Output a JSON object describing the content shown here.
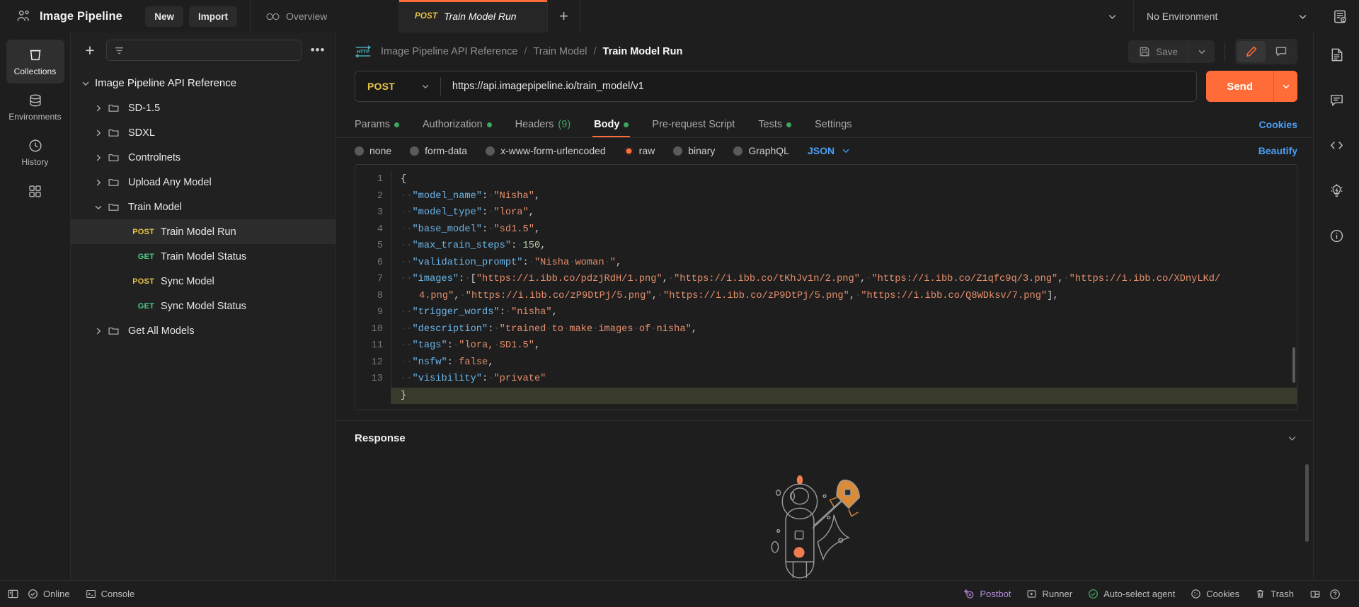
{
  "topbar": {
    "workspace_name": "Image Pipeline",
    "workspace_icon": "users-icon",
    "new_label": "New",
    "import_label": "Import",
    "tabs": [
      {
        "label": "Overview",
        "icon": "overview-glasses-icon",
        "method": "",
        "active": false
      },
      {
        "label": "Train Model Run",
        "icon": "",
        "method": "POST",
        "active": true
      }
    ],
    "new_tab_label": "+",
    "environment": "No Environment",
    "env_eye_icon": "environment-quick-look-icon"
  },
  "left_rail": [
    {
      "label": "Collections",
      "icon": "collections-icon",
      "active": true
    },
    {
      "label": "Environments",
      "icon": "environments-icon",
      "active": false
    },
    {
      "label": "History",
      "icon": "history-icon",
      "active": false
    },
    {
      "label": "",
      "icon": "apps-grid-icon",
      "active": false
    }
  ],
  "sidebar": {
    "add_icon": "plus-icon",
    "filter_icon": "filter-icon",
    "more_icon": "more-options-icon",
    "search_placeholder": "",
    "tree": [
      {
        "label": "Image Pipeline API Reference",
        "level": 0,
        "type": "collection",
        "expanded": true,
        "method": ""
      },
      {
        "label": "SD-1.5",
        "level": 1,
        "type": "folder",
        "expanded": false,
        "method": ""
      },
      {
        "label": "SDXL",
        "level": 1,
        "type": "folder",
        "expanded": false,
        "method": ""
      },
      {
        "label": "Controlnets",
        "level": 1,
        "type": "folder",
        "expanded": false,
        "method": ""
      },
      {
        "label": "Upload Any Model",
        "level": 1,
        "type": "folder",
        "expanded": false,
        "method": ""
      },
      {
        "label": "Train Model",
        "level": 1,
        "type": "folder",
        "expanded": true,
        "method": ""
      },
      {
        "label": "Train Model Run",
        "level": 2,
        "type": "request",
        "method": "POST",
        "selected": true
      },
      {
        "label": "Train Model Status",
        "level": 2,
        "type": "request",
        "method": "GET",
        "selected": false
      },
      {
        "label": "Sync Model",
        "level": 2,
        "type": "request",
        "method": "POST",
        "selected": false
      },
      {
        "label": "Sync Model Status",
        "level": 2,
        "type": "request",
        "method": "GET",
        "selected": false
      },
      {
        "label": "Get All Models",
        "level": 1,
        "type": "folder",
        "expanded": false,
        "method": ""
      }
    ]
  },
  "request": {
    "breadcrumb": {
      "icon": "http-protocol-icon",
      "items": [
        "Image Pipeline API Reference",
        "Train Model",
        "Train Model Run"
      ],
      "separator": "/"
    },
    "save_label": "Save",
    "save_icon": "floppy-save-icon",
    "save_caret_icon": "chevron-down-icon",
    "edit_icon": "pencil-edit-icon",
    "comment_icon": "comment-icon",
    "method": "POST",
    "url": "https://api.imagepipeline.io/train_model/v1",
    "send_label": "Send",
    "send_caret_icon": "chevron-down-icon",
    "tabs": [
      {
        "label": "Params",
        "dot": true,
        "count": "",
        "active": false
      },
      {
        "label": "Authorization",
        "dot": true,
        "count": "",
        "active": false
      },
      {
        "label": "Headers",
        "dot": false,
        "count": "(9)",
        "active": false
      },
      {
        "label": "Body",
        "dot": true,
        "count": "",
        "active": true
      },
      {
        "label": "Pre-request Script",
        "dot": false,
        "count": "",
        "active": false
      },
      {
        "label": "Tests",
        "dot": true,
        "count": "",
        "active": false
      },
      {
        "label": "Settings",
        "dot": false,
        "count": "",
        "active": false
      }
    ],
    "cookies_label": "Cookies",
    "body_types": [
      {
        "label": "none",
        "selected": false
      },
      {
        "label": "form-data",
        "selected": false
      },
      {
        "label": "x-www-form-urlencoded",
        "selected": false
      },
      {
        "label": "raw",
        "selected": true
      },
      {
        "label": "binary",
        "selected": false
      },
      {
        "label": "GraphQL",
        "selected": false
      }
    ],
    "raw_format": "JSON",
    "raw_format_caret_icon": "chevron-down-icon",
    "beautify_label": "Beautify"
  },
  "editor": {
    "line_numbers": [
      "1",
      "2",
      "3",
      "4",
      "5",
      "6",
      "7",
      "",
      "8",
      "9",
      "10",
      "11",
      "12",
      "13"
    ],
    "active_line": 13,
    "raw_json": "{\n  \"model_name\": \"Nisha\",\n  \"model_type\": \"lora\",\n  \"base_model\": \"sd1.5\",\n  \"max_train_steps\": 150,\n  \"validation_prompt\": \"Nisha woman \",\n  \"images\": [\"https://i.ibb.co/pdzjRdH/1.png\", \"https://i.ibb.co/tKhJv1n/2.png\", \"https://i.ibb.co/Z1qfc9q/3.png\", \"https://i.ibb.co/XDnyLKd/4.png\", \"https://i.ibb.co/zP9DtPj/5.png\", \"https://i.ibb.co/zP9DtPj/5.png\", \"https://i.ibb.co/Q8WDksv/7.png\"],\n  \"trigger_words\": \"nisha\",\n  \"description\": \"trained to make images of nisha\",\n  \"tags\": \"lora, SD1.5\",\n  \"nsfw\": false,\n  \"visibility\": \"private\"\n}",
    "fields": {
      "model_name": "Nisha",
      "model_type": "lora",
      "base_model": "sd1.5",
      "max_train_steps": 150,
      "validation_prompt": "Nisha woman ",
      "images": [
        "https://i.ibb.co/pdzjRdH/1.png",
        "https://i.ibb.co/tKhJv1n/2.png",
        "https://i.ibb.co/Z1qfc9q/3.png",
        "https://i.ibb.co/XDnyLKd/4.png",
        "https://i.ibb.co/zP9DtPj/5.png",
        "https://i.ibb.co/zP9DtPj/5.png",
        "https://i.ibb.co/Q8WDksv/7.png"
      ],
      "trigger_words": "nisha",
      "description": "trained to make images of nisha",
      "tags": "lora, SD1.5",
      "nsfw": false,
      "visibility": "private"
    }
  },
  "response": {
    "title": "Response",
    "collapse_icon": "chevron-down-icon",
    "placeholder_illustration": "astronaut-rocket-illustration"
  },
  "right_rail": [
    {
      "icon": "documentation-icon"
    },
    {
      "icon": "comment-icon"
    },
    {
      "icon": "code-snippet-icon"
    },
    {
      "icon": "lightbulb-info-icon"
    },
    {
      "icon": "info-circle-icon"
    }
  ],
  "status_bar": {
    "left": [
      {
        "label": "",
        "icon": "sidebar-toggle-icon"
      },
      {
        "label": "Online",
        "icon": "online-check-icon"
      },
      {
        "label": "Console",
        "icon": "console-icon"
      }
    ],
    "right": [
      {
        "label": "Postbot",
        "icon": "postbot-icon",
        "color": "#b58ce0"
      },
      {
        "label": "Runner",
        "icon": "runner-play-icon",
        "color": ""
      },
      {
        "label": "Auto-select agent",
        "icon": "agent-check-icon",
        "color": ""
      },
      {
        "label": "Cookies",
        "icon": "cookie-icon",
        "color": ""
      },
      {
        "label": "Trash",
        "icon": "trash-icon",
        "color": ""
      },
      {
        "label": "",
        "icon": "layout-panes-icon",
        "color": ""
      },
      {
        "label": "",
        "icon": "help-circle-icon",
        "color": ""
      }
    ]
  },
  "colors": {
    "accent": "#ff6c37",
    "link": "#4a9ef5",
    "post": "#e8c547",
    "get": "#4ec98a",
    "green_dot": "#3ea662",
    "bg": "#1e1e1e",
    "sidebar_bg": "#212121"
  }
}
